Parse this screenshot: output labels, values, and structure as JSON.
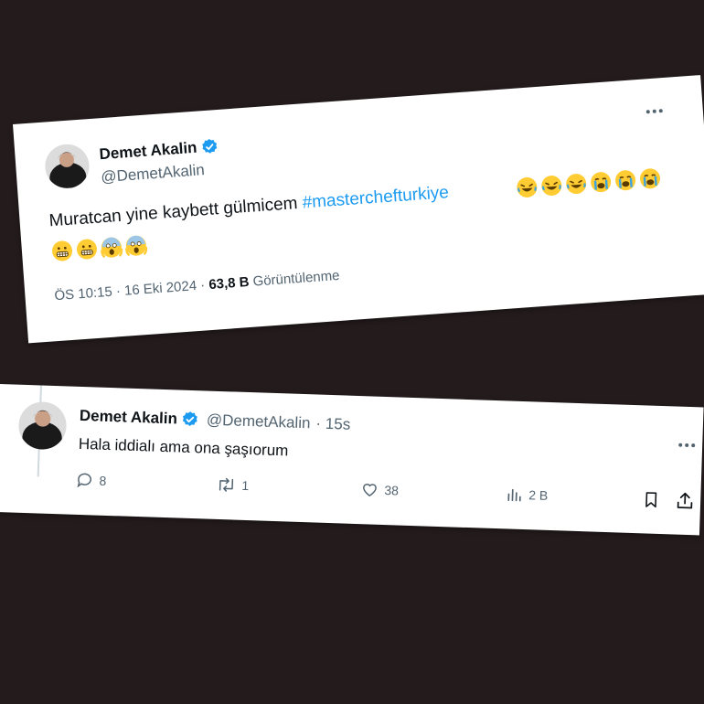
{
  "tweet1": {
    "name": "Demet Akalin",
    "handle": "@DemetAkalin",
    "text": "Muratcan yine kaybett gülmicem ",
    "hashtag": "#masterchefturkiye",
    "emojis_line1": [
      "rolling-laughing",
      "rolling-laughing",
      "rolling-laughing",
      "crying",
      "crying",
      "crying"
    ],
    "emojis_line2": [
      "grimacing",
      "grimacing",
      "screaming",
      "screaming"
    ],
    "time": "ÖS 10:15 · 16 Eki 2024 · ",
    "views_count": "63,8 B",
    "views_label": "Görüntülenme"
  },
  "tweet2": {
    "name": "Demet Akalin",
    "handle": "@DemetAkalin",
    "time": "· 15s",
    "text": "Hala iddialı ama ona şaşıorum",
    "replies": "8",
    "retweets": "1",
    "likes": "38",
    "views": "2 B"
  },
  "colors": {
    "background": "#231b1c",
    "accent": "#1d9bf0",
    "secondary_text": "#536471"
  }
}
